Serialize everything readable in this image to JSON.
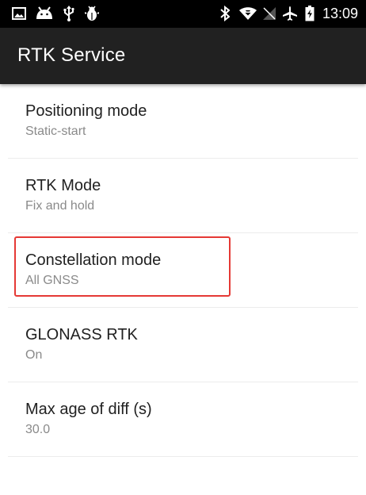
{
  "status_bar": {
    "time": "13:09",
    "left_icons": [
      "image-icon",
      "android-icon",
      "usb-icon",
      "android-debug-icon"
    ],
    "right_icons": [
      "bluetooth-icon",
      "wifi-icon",
      "no-signal-icon",
      "airplane-icon",
      "battery-charging-icon"
    ]
  },
  "app_bar": {
    "title": "RTK Service"
  },
  "preferences": [
    {
      "title": "Positioning mode",
      "summary": "Static-start"
    },
    {
      "title": "RTK Mode",
      "summary": "Fix and hold"
    },
    {
      "title": "Constellation mode",
      "summary": "All GNSS"
    },
    {
      "title": "GLONASS RTK",
      "summary": "On"
    },
    {
      "title": "Max age of diff (s)",
      "summary": "30.0"
    }
  ],
  "colors": {
    "status_bar": "#000000",
    "app_bar": "#212121",
    "highlight": "#e53935"
  }
}
